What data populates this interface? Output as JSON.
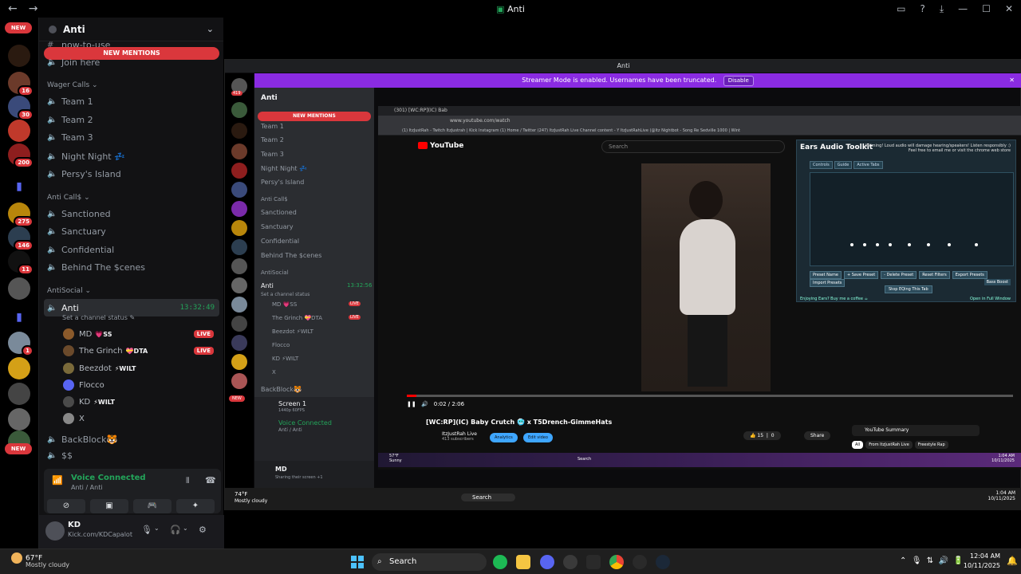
{
  "window": {
    "title": "Anti"
  },
  "rail": {
    "new_label": "NEW",
    "badges": [
      "16",
      "30",
      "200",
      "275",
      "146",
      "11",
      "1"
    ]
  },
  "left_panel": {
    "guild_name": "Anti",
    "new_mentions": "NEW MENTIONS",
    "partial_items": [
      "now-to-use",
      "Join here"
    ],
    "categories": {
      "wager": "Wager Calls",
      "anticall": "Anti Call$",
      "antisocial": "AntiSocial"
    },
    "wager_channels": [
      "Team 1",
      "Team 2",
      "Team 3",
      "Night Night 💤",
      "Persy's Island"
    ],
    "anticall_channels": [
      "Sanctioned",
      "Sanctuary",
      "Confidential",
      "Behind The $cenes"
    ],
    "active_channel": {
      "name": "Anti",
      "time": "13:32:49",
      "status": "Set a channel status"
    },
    "members": [
      {
        "name": "MD",
        "tag": "💗SS",
        "live": "LIVE"
      },
      {
        "name": "The Grinch",
        "tag": "💝DTA",
        "live": "LIVE"
      },
      {
        "name": "Beezdot",
        "tag": "⚡WILT",
        "live": ""
      },
      {
        "name": "Flocco",
        "tag": "",
        "live": ""
      },
      {
        "name": "KD",
        "tag": "⚡WILT",
        "live": ""
      },
      {
        "name": "X",
        "tag": "",
        "live": ""
      }
    ],
    "more_channels": [
      "BackBlock🐯",
      "$$"
    ],
    "voice": {
      "title": "Voice Connected",
      "sub": "Anti / Anti"
    },
    "user": {
      "name": "KD",
      "status": "Kick.com/KDCapalot"
    }
  },
  "share": {
    "window_title": "Anti",
    "streamer_text": "Streamer Mode is enabled. Usernames have been truncated.",
    "disable_label": "Disable",
    "mini_badge": "419",
    "mini_guild": "Anti",
    "mini_mentions": "NEW MENTIONS",
    "mini_channels": [
      "Team 1",
      "Team 2",
      "Team 3",
      "Night Night 💤",
      "Persy's Island"
    ],
    "mini_category": "Anti Call$",
    "mini_channels2": [
      "Sanctioned",
      "Sanctuary",
      "Confidential",
      "Behind The $cenes"
    ],
    "mini_category2": "AntiSocial",
    "mini_active": "Anti",
    "mini_time": "13:32:56",
    "mini_status": "Set a channel status",
    "mini_members": [
      "MD 💗SS",
      "The Grinch 💝DTA",
      "Beezdot ⚡WILT",
      "Flocco",
      "KD ⚡WILT",
      "X"
    ],
    "mini_live": "LIVE",
    "mini_backblock": "BackBlock🐯",
    "mini_screen": "Screen 1",
    "mini_screen_sub": "1440p 60FPS",
    "mini_voice": "Voice Connected",
    "mini_voice_sub": "Anti / Anti",
    "mini_user": "MD",
    "mini_user_sub": "Sharing their screen +1",
    "mini_new": "NEW",
    "browser": {
      "tab": "(301) [WC:RP](IC) Bab",
      "url": "www.youtube.com/watch",
      "bookmarks": "(1) ItzJustRah - Twitch   ItzJustrah | Kick   Instagram   (1) Home / Twitter   (247) ItzJustRah Live   Channel content - Y   ItzJustRahLive (@Itz   Nightbot - Song Re   Sedville 1000 | Wint",
      "yt_logo": "YouTube",
      "search_placeholder": "Search",
      "time": "0:02 / 2:06",
      "video_title": "[WC:RP](IC) Baby Crutch 🥶 x T5Drench-GimmeHats",
      "channel": "ItzJustRah Live",
      "subs": "413 subscribers",
      "analytics": "Analytics",
      "edit": "Edit video",
      "likes": "15",
      "dislikes": "0",
      "share": "Share",
      "summary": "YouTube Summary",
      "chips": [
        "All",
        "From ItzJustRah Live",
        "Freestyle Rap"
      ]
    },
    "ears": {
      "title": "Ears Audio Toolkit",
      "warning": "Warning! Loud audio will damage hearing/speakers! Listen responsibly :)",
      "warning2": "Feel free to email me or visit the chrome web store",
      "tabs": [
        "Controls",
        "Guide",
        "Active Tabs"
      ],
      "buttons": [
        "Preset Name",
        "+ Save Preset",
        "- Delete Preset",
        "Reset Filters",
        "Export Presets",
        "Import Presets"
      ],
      "bass": "Bass Boost",
      "stop": "Stop EQing This Tab",
      "foot": "Enjoying Ears? Buy me a coffee ☕",
      "foot2": "Open in Full Window"
    },
    "inner_taskbar": {
      "temp": "57°F",
      "cond": "Sunny",
      "search": "Search",
      "time": "1:04 AM",
      "date": "10/11/2025"
    },
    "share_taskbar": {
      "temp": "74°F",
      "cond": "Mostly cloudy",
      "search": "Search",
      "time": "1:04 AM",
      "date": "10/11/2025"
    }
  },
  "taskbar": {
    "temp": "67°F",
    "cond": "Mostly cloudy",
    "search": "Search",
    "time": "12:04 AM",
    "date": "10/11/2025"
  }
}
